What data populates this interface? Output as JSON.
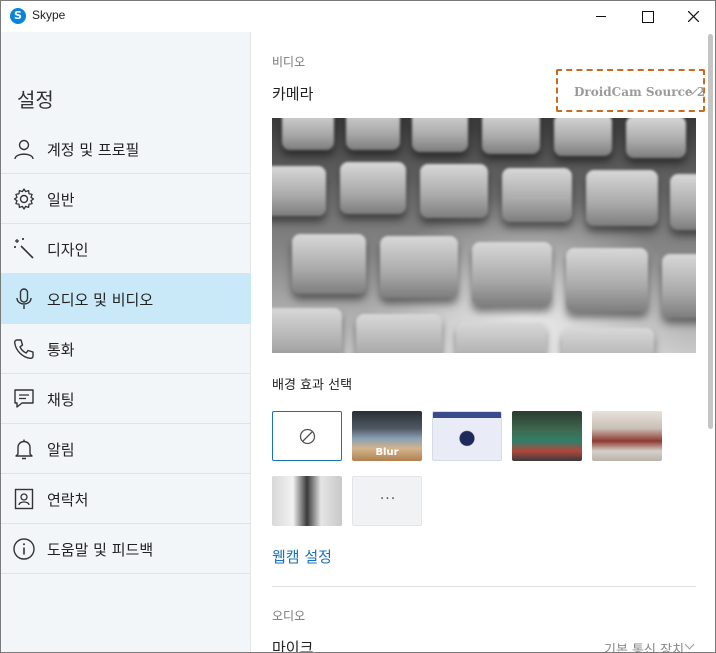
{
  "window": {
    "app_title": "Skype",
    "logo_glyph": "S"
  },
  "sidebar": {
    "title": "설정",
    "items": [
      {
        "label": "계정 및 프로필",
        "icon": "person-icon"
      },
      {
        "label": "일반",
        "icon": "gear-icon"
      },
      {
        "label": "디자인",
        "icon": "magic-wand-icon"
      },
      {
        "label": "오디오 및 비디오",
        "icon": "microphone-icon",
        "active": true
      },
      {
        "label": "통화",
        "icon": "phone-icon"
      },
      {
        "label": "채팅",
        "icon": "chat-icon"
      },
      {
        "label": "알림",
        "icon": "bell-icon"
      },
      {
        "label": "연락처",
        "icon": "contact-card-icon"
      },
      {
        "label": "도움말 및 피드백",
        "icon": "info-icon"
      }
    ]
  },
  "video": {
    "section_label": "비디오",
    "camera_label": "카메라",
    "camera_selected": "DroidCam Source 2",
    "background_label": "배경 효과 선택",
    "blur_label": "Blur",
    "more_label": "···",
    "webcam_settings_link": "웹캠 설정"
  },
  "audio": {
    "section_label": "오디오",
    "mic_label": "마이크",
    "mic_selected": "기본 통신 장치"
  },
  "colors": {
    "accent": "#1a73b8",
    "sidebar_bg": "#f3f6f9",
    "active_item_bg": "#c9e9f8",
    "highlight_border": "#c96a20"
  }
}
